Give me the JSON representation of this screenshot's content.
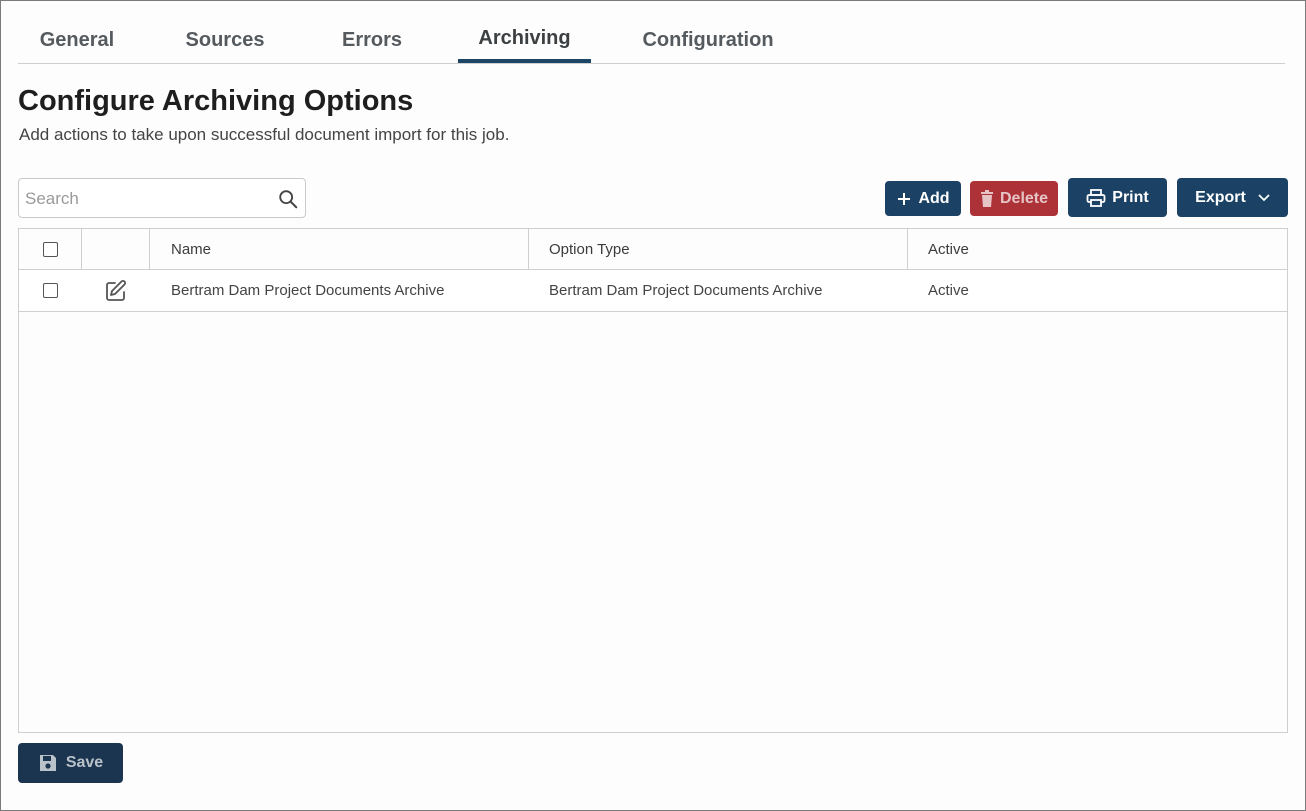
{
  "tabs": [
    {
      "label": "General",
      "active": false
    },
    {
      "label": "Sources",
      "active": false
    },
    {
      "label": "Errors",
      "active": false
    },
    {
      "label": "Archiving",
      "active": true
    },
    {
      "label": "Configuration",
      "active": false
    }
  ],
  "page": {
    "title": "Configure Archiving Options",
    "subtitle": "Add actions to take upon successful document import for this job."
  },
  "search": {
    "placeholder": "Search",
    "value": "",
    "icon": "search-icon"
  },
  "toolbar": {
    "add_label": "Add",
    "delete_label": "Delete",
    "print_label": "Print",
    "export_label": "Export",
    "icons": {
      "add": "plus-icon",
      "delete": "trash-icon",
      "print": "printer-icon",
      "export": "chevron-down-icon"
    }
  },
  "table": {
    "columns": [
      "",
      "",
      "Name",
      "Option Type",
      "Active"
    ],
    "rows": [
      {
        "checked": false,
        "edit_icon": "edit-icon",
        "name": "Bertram Dam Project Documents Archive",
        "option_type": "Bertram Dam Project Documents Archive",
        "active": "Active"
      }
    ]
  },
  "footer": {
    "save_label": "Save",
    "save_icon": "floppy-disk-icon"
  },
  "colors": {
    "primary": "#1b4264",
    "danger": "#ad3238",
    "save": "#1b3550",
    "tab_indicator": "#1c4566"
  }
}
